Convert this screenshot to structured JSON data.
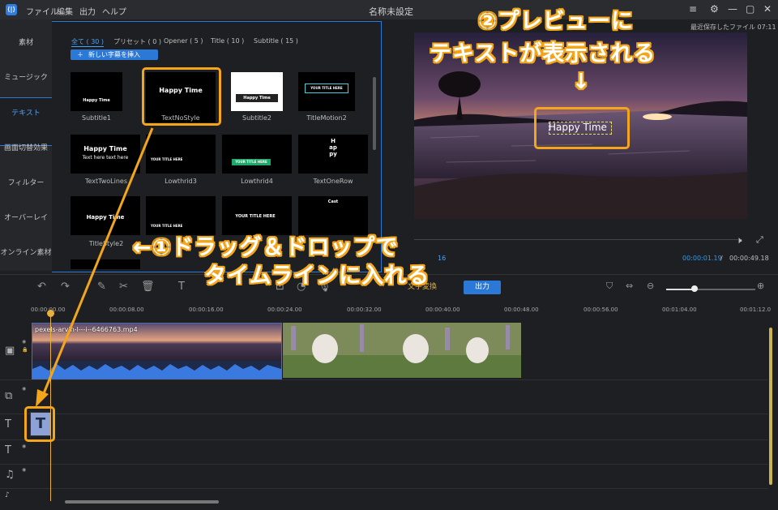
{
  "app": {
    "title": "名称未設定",
    "logo": "⟨|⟩",
    "menu": [
      "ファイル",
      "編集",
      "出力",
      "ヘルプ"
    ],
    "last_saved": "最近保存したファイル 07:11"
  },
  "sidenav": {
    "items": [
      "素材",
      "ミュージック",
      "テキスト",
      "画面切替効果",
      "フィルター",
      "オーバーレイ",
      "オンライン素材"
    ],
    "selected_index": 2
  },
  "library": {
    "tabs": [
      "全て ( 30 )",
      "プリセット ( 0 )",
      "Opener ( 5 )",
      "Title ( 10 )",
      "Subtitle ( 15 )"
    ],
    "active_tab_index": 0,
    "insert_button": "新しい字幕を挿入",
    "thumbnails": [
      {
        "label": "Subtitle1",
        "preview": "Happy Time"
      },
      {
        "label": "TextNoStyle",
        "preview": "Happy Time"
      },
      {
        "label": "Subtitle2",
        "preview": "Happy Time"
      },
      {
        "label": "TitleMotion2",
        "preview": "YOUR TITLE HERE"
      },
      {
        "label": "TextTwoLines",
        "preview": "Happy Time",
        "preview2": "Text here text here"
      },
      {
        "label": "Lowthrid3",
        "preview": "YOUR TITLE HERE"
      },
      {
        "label": "Lowthrid4",
        "preview": "YOUR TITLE HERE"
      },
      {
        "label": "TextOneRow",
        "preview": "Happy"
      },
      {
        "label": "TitleStyle2",
        "preview": "Happy Time"
      },
      {
        "label": "",
        "preview": "YOUR TITLE HERE"
      },
      {
        "label": "",
        "preview": "YOUR TITLE HERE"
      },
      {
        "label": "",
        "preview": "Cast"
      }
    ]
  },
  "preview": {
    "overlay_text": "Happy Time",
    "current_time": "00:00:01.19",
    "separator": "/",
    "total_time": "00:00:49.18",
    "partial_speed": "16"
  },
  "toolbar": {
    "text_edit": "文字変換",
    "export": "出力"
  },
  "timeline": {
    "ticks": [
      "00:00:00.00",
      "00:00:08.00",
      "00:00:16.00",
      "00:00:24.00",
      "00:00:32.00",
      "00:00:40.00",
      "00:00:48.00",
      "00:00:56.00",
      "00:01:04.00",
      "00:01:12.0"
    ],
    "clip1_name": "pexels-arvin-l---i--6466763.mp4",
    "text_clip_letter": "T",
    "zoom_fraction": 0.3
  },
  "annotations": {
    "callout1_line1": "←①ドラッグ＆ドロップで",
    "callout1_line2": "タイムラインに入れる",
    "callout2_line1": "②プレビューに",
    "callout2_line2": "テキストが表示される",
    "callout2_arrow": "↓"
  },
  "colors": {
    "accent": "#2b78d6",
    "annotation": "#f3a61b",
    "timecode": "#2b9bf0"
  }
}
